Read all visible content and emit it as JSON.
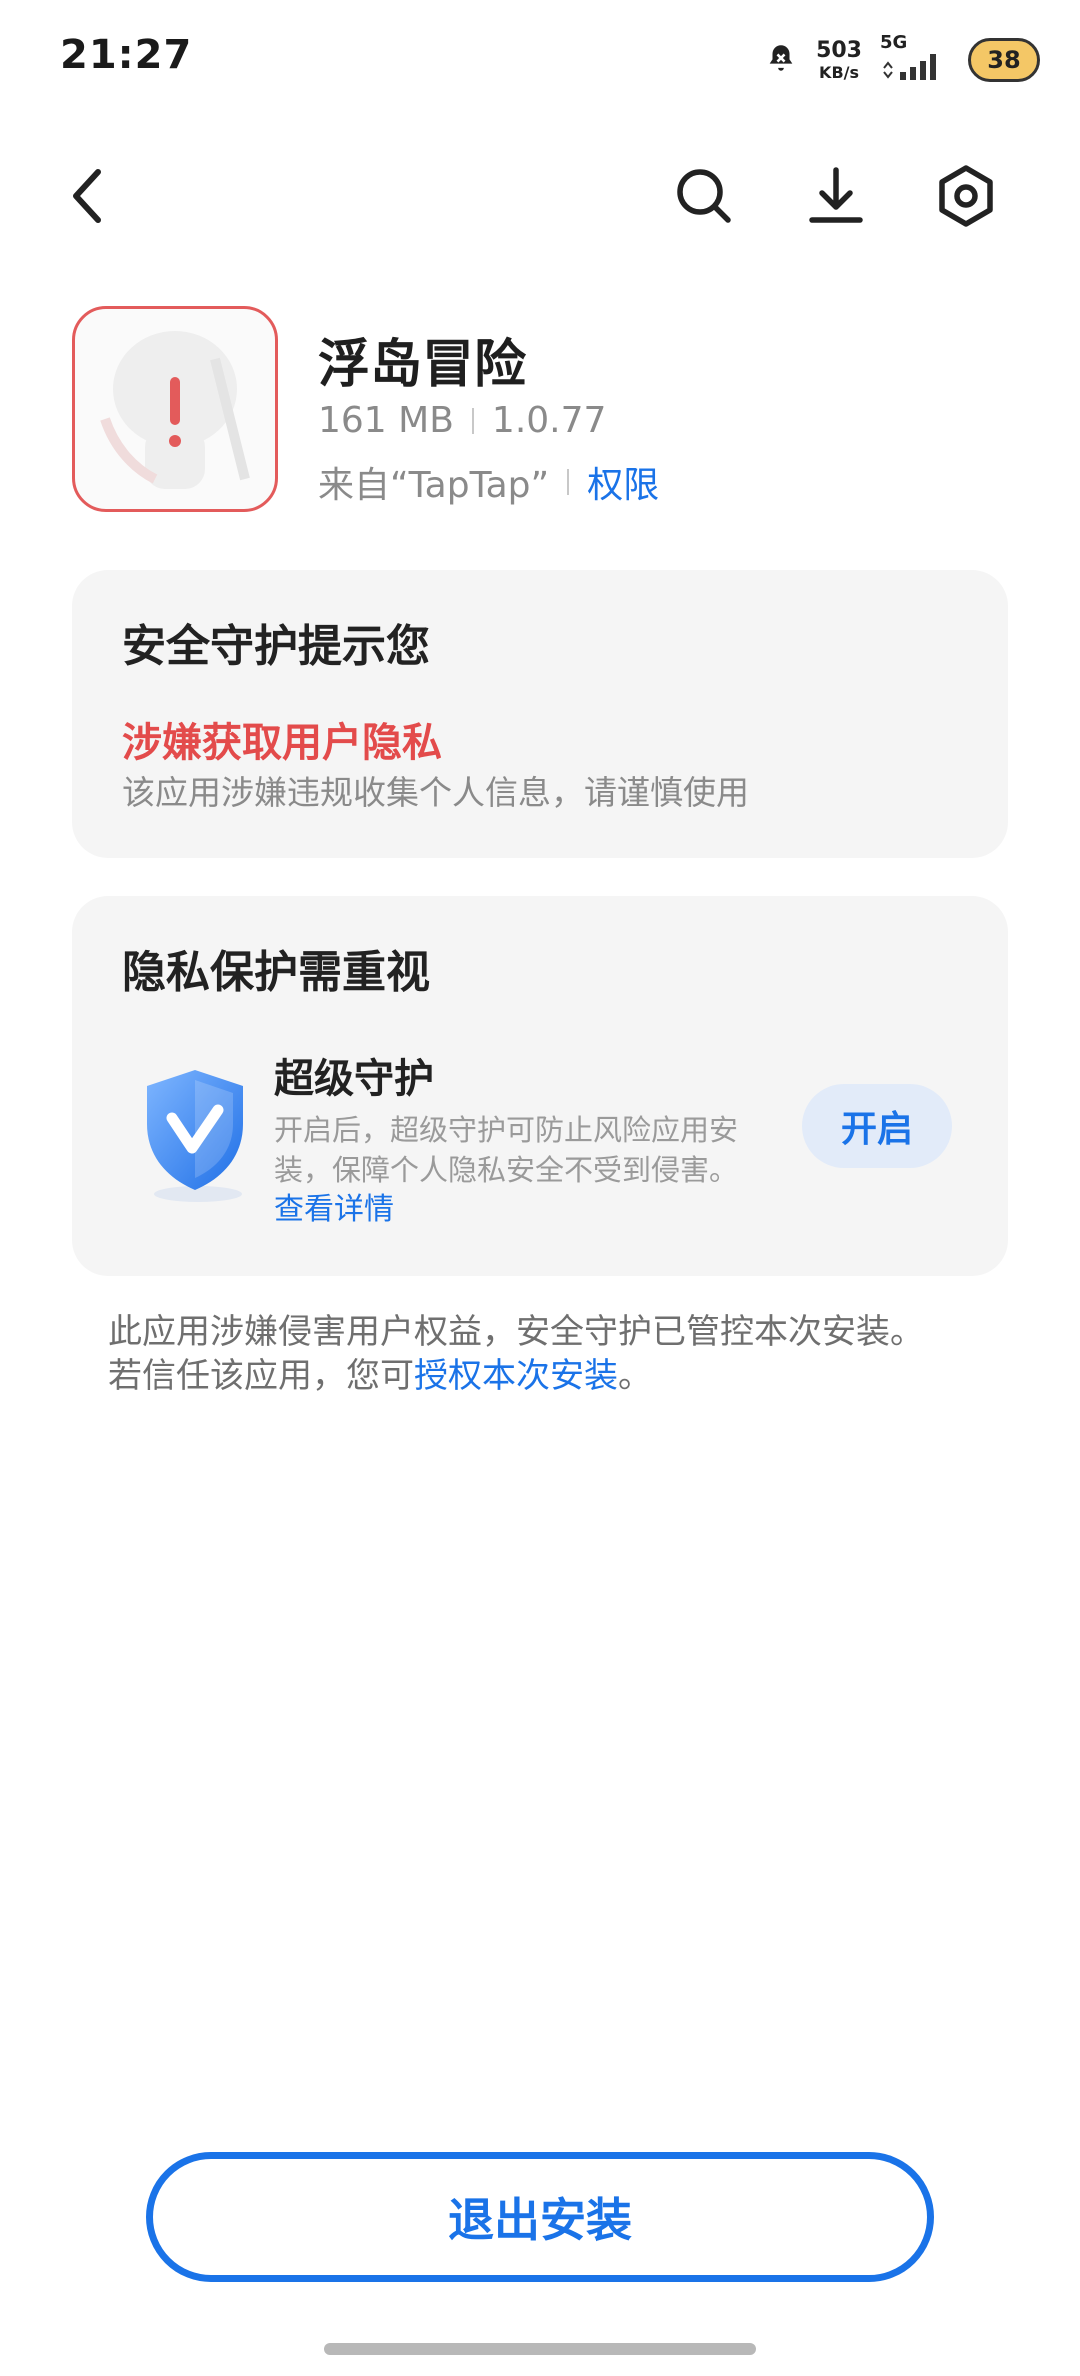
{
  "status_bar": {
    "time": "21:27",
    "net_speed_value": "503",
    "net_speed_unit": "KB/s",
    "network_type": "5G",
    "battery": "38",
    "icons": [
      "alarm-mute-icon",
      "signal-icon"
    ]
  },
  "nav": {
    "icons": [
      "back-icon",
      "search-icon",
      "download-icon",
      "settings-icon"
    ]
  },
  "app": {
    "name": "浮岛冒险",
    "size": "161 MB",
    "version": "1.0.77",
    "source": "来自“TapTap”",
    "permissions_link": "权限"
  },
  "security_card": {
    "title": "安全守护提示您",
    "warning_title": "涉嫌获取用户隐私",
    "warning_desc": "该应用涉嫌违规收集个人信息，请谨慎使用"
  },
  "privacy_card": {
    "title": "隐私保护需重视",
    "feature_title": "超级守护",
    "feature_desc_line1": "开启后，超级守护可防止风险应用安",
    "feature_desc_line2": "装，保障个人隐私安全不受到侵害。",
    "details_link": "查看详情",
    "enable_button": "开启"
  },
  "notice": {
    "line1": "此应用涉嫌侵害用户权益，安全守护已管控本次安装。",
    "line2_prefix": "若信任该应用，您可",
    "line2_link": "授权本次安装",
    "line2_suffix": "。"
  },
  "exit_button": "退出安装",
  "colors": {
    "accent": "#1a73e8",
    "warning": "#e34b4b",
    "card_bg": "#f5f5f5"
  }
}
